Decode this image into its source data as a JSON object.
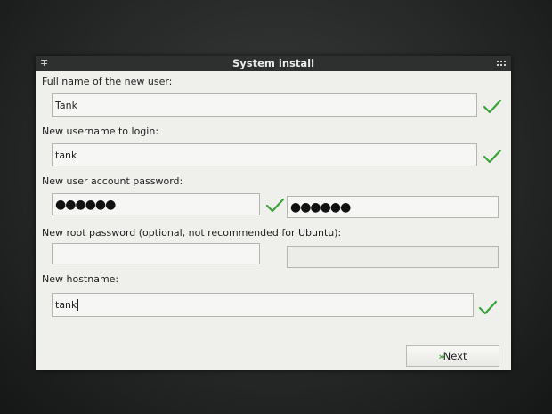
{
  "window": {
    "title": "System install",
    "pin_glyph": "∓"
  },
  "form": {
    "fullname": {
      "label": "Full name of the new user:",
      "value": "Tank",
      "valid": true
    },
    "username": {
      "label": "New username to login:",
      "value": "tank",
      "valid": true
    },
    "password": {
      "label": "New user account password:",
      "value_masked": "●●●●●●",
      "confirm_masked": "●●●●●●",
      "valid": true
    },
    "root_password": {
      "label": "New root password (optional, not recommended for Ubuntu):",
      "value": "",
      "confirm": ""
    },
    "hostname": {
      "label": "New hostname:",
      "value": "tank",
      "valid": true
    }
  },
  "actions": {
    "next_arrows": "»",
    "next_label": "Next"
  },
  "colors": {
    "check": "#3aa33a",
    "titlebar": "#2e302f",
    "window_bg": "#efefec",
    "next_arrow": "#3a9c2e"
  },
  "icons": {
    "check": "check-icon",
    "pin": "pin-icon",
    "grip": "grip-icon",
    "next_arrow": "double-chevron-right-icon"
  }
}
